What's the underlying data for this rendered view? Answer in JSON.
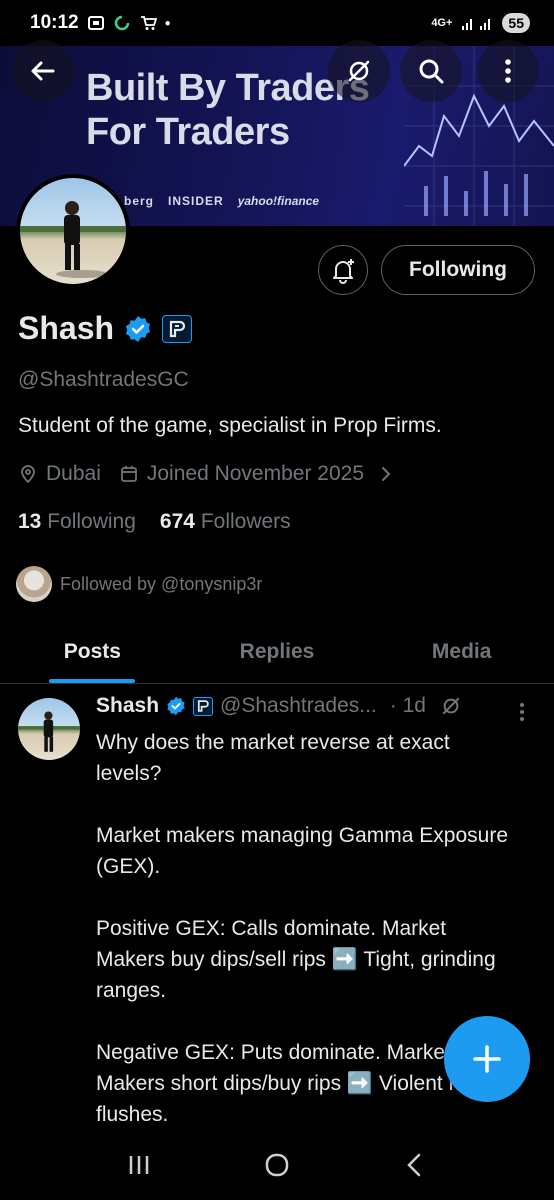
{
  "status": {
    "time": "10:12",
    "network": "4G+",
    "battery": "55"
  },
  "banner": {
    "line1": "Built By Traders",
    "line2": "For Traders",
    "logo1": "berg",
    "logo2": "INSIDER",
    "logo3": "yahoo!finance"
  },
  "profile": {
    "name": "Shash",
    "handle": "@ShashtradesGC",
    "bio": "Student of the game, specialist in Prop Firms.",
    "location": "Dubai",
    "joined": "Joined November 2025",
    "following_count": "13",
    "following_label": "Following",
    "followers_count": "674",
    "followers_label": "Followers",
    "followed_by": "Followed by @tonysnip3r",
    "follow_button": "Following"
  },
  "tabs": [
    {
      "label": "Posts",
      "active": true
    },
    {
      "label": "Replies",
      "active": false
    },
    {
      "label": "Media",
      "active": false
    }
  ],
  "post": {
    "name": "Shash",
    "handle": "@Shashtrades...",
    "time": "· 1d",
    "paragraphs": [
      "Why does the market reverse at exact levels?",
      "Market makers managing Gamma Exposure (GEX).",
      "Positive GEX: Calls dominate. Market Makers buy dips/sell rips ➡️ Tight, grinding ranges.",
      "Negative GEX: Puts dominate. Market Makers short dips/buy rips ➡️ Violent market flushes."
    ]
  },
  "colors": {
    "accent": "#1d9bf0",
    "muted": "#71767b",
    "text": "#e7e9ea",
    "border": "#2f3336"
  }
}
